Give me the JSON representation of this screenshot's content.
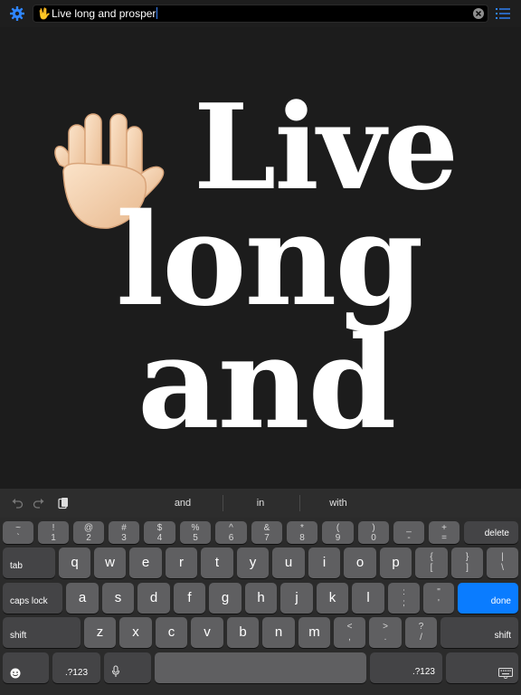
{
  "search": {
    "emoji": "🖖",
    "value": "Live long and prosper"
  },
  "display": {
    "line1": "Live",
    "line2": "long",
    "line3": "and"
  },
  "suggestions": [
    "and",
    "in",
    "with"
  ],
  "keyboard": {
    "number_row": [
      {
        "top": "~",
        "bot": "`"
      },
      {
        "top": "!",
        "bot": "1"
      },
      {
        "top": "@",
        "bot": "2"
      },
      {
        "top": "#",
        "bot": "3"
      },
      {
        "top": "$",
        "bot": "4"
      },
      {
        "top": "%",
        "bot": "5"
      },
      {
        "top": "^",
        "bot": "6"
      },
      {
        "top": "&",
        "bot": "7"
      },
      {
        "top": "*",
        "bot": "8"
      },
      {
        "top": "(",
        "bot": "9"
      },
      {
        "top": ")",
        "bot": "0"
      },
      {
        "top": "_",
        "bot": "-"
      },
      {
        "top": "+",
        "bot": "="
      }
    ],
    "delete": "delete",
    "tab": "tab",
    "row2": [
      "q",
      "w",
      "e",
      "r",
      "t",
      "y",
      "u",
      "i",
      "o",
      "p"
    ],
    "row2_extra": [
      {
        "top": "{",
        "bot": "["
      },
      {
        "top": "}",
        "bot": "]"
      },
      {
        "top": "|",
        "bot": "\\"
      }
    ],
    "caps": "caps lock",
    "row3": [
      "a",
      "s",
      "d",
      "f",
      "g",
      "h",
      "j",
      "k",
      "l"
    ],
    "row3_extra": [
      {
        "top": ":",
        "bot": ";"
      },
      {
        "top": "\"",
        "bot": "'"
      }
    ],
    "done": "done",
    "shift_left": "shift",
    "row4": [
      "z",
      "x",
      "c",
      "v",
      "b",
      "n",
      "m"
    ],
    "row4_extra": [
      {
        "top": "<",
        "bot": ","
      },
      {
        "top": ">",
        "bot": "."
      },
      {
        "top": "?",
        "bot": "/"
      }
    ],
    "shift_right": "shift",
    "numbers_left": ".?123",
    "numbers_right": ".?123"
  },
  "colors": {
    "accent": "#0a7cff",
    "background": "#1c1c1c"
  }
}
